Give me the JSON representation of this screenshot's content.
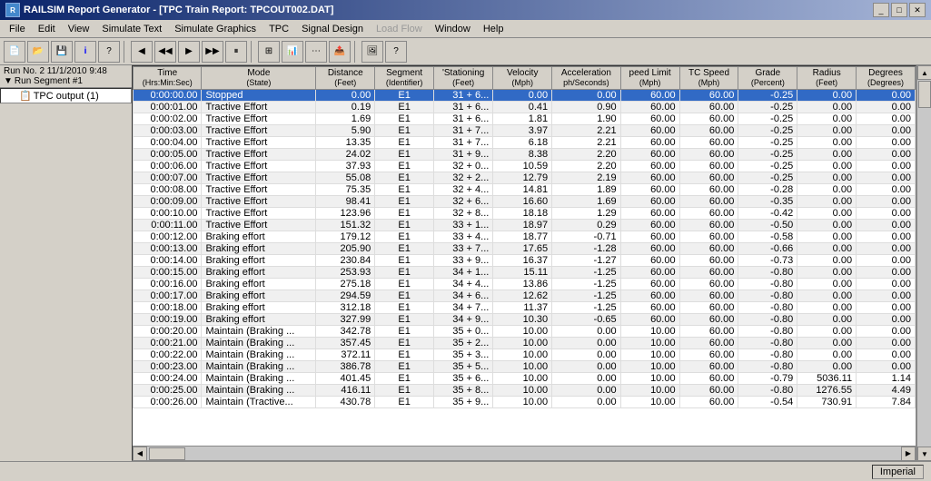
{
  "titleBar": {
    "title": "RAILSIM Report Generator - [TPC Train Report: TPCOUT002.DAT]",
    "icon": "R",
    "controls": [
      "_",
      "□",
      "✕"
    ]
  },
  "menuBar": {
    "items": [
      {
        "label": "File",
        "disabled": false
      },
      {
        "label": "Edit",
        "disabled": false
      },
      {
        "label": "View",
        "disabled": false
      },
      {
        "label": "Simulate Text",
        "disabled": false
      },
      {
        "label": "Simulate Graphics",
        "disabled": false
      },
      {
        "label": "TPC",
        "disabled": false
      },
      {
        "label": "Signal Design",
        "disabled": false
      },
      {
        "label": "Load Flow",
        "disabled": true
      },
      {
        "label": "Window",
        "disabled": false
      },
      {
        "label": "Help",
        "disabled": false
      }
    ]
  },
  "infoBar": {
    "runNo": "Run No. 2  11/1/2010 9:48",
    "segment": "Run Segment #1"
  },
  "treeItems": [
    {
      "label": "TPC output (1)",
      "level": 2
    }
  ],
  "tableHeaders": [
    {
      "label": "Time",
      "sub": "(Hrs:Min:Sec)"
    },
    {
      "label": "Mode",
      "sub": "(State)"
    },
    {
      "label": "Distance",
      "sub": "(Feet)"
    },
    {
      "label": "Segment",
      "sub": "(Identifier)"
    },
    {
      "label": "Stationing",
      "sub": "(Feet)"
    },
    {
      "label": "Velocity",
      "sub": "(Mph)"
    },
    {
      "label": "Acceleration",
      "sub": "ph/Seconds)"
    },
    {
      "label": "Speed Limit",
      "sub": "(Mph)"
    },
    {
      "label": "TC Speed",
      "sub": "(Mph)"
    },
    {
      "label": "Grade",
      "sub": "(Percent)"
    },
    {
      "label": "Radius",
      "sub": "(Feet)"
    },
    {
      "label": "Degrees",
      "sub": "(Degrees)"
    }
  ],
  "tableRows": [
    {
      "time": "0:00:00.00",
      "mode": "Stopped",
      "dist": "0.00",
      "seg": "E1",
      "stat": "31 + 6...",
      "vel": "0.00",
      "accel": "0.00",
      "speedLim": "60.00",
      "tcSpeed": "60.00",
      "grade": "-0.25",
      "radius": "0.00",
      "degrees": "0.00",
      "selected": true
    },
    {
      "time": "0:00:01.00",
      "mode": "Tractive Effort",
      "dist": "0.19",
      "seg": "E1",
      "stat": "31 + 6...",
      "vel": "0.41",
      "accel": "0.90",
      "speedLim": "60.00",
      "tcSpeed": "60.00",
      "grade": "-0.25",
      "radius": "0.00",
      "degrees": "0.00",
      "selected": false
    },
    {
      "time": "0:00:02.00",
      "mode": "Tractive Effort",
      "dist": "1.69",
      "seg": "E1",
      "stat": "31 + 6...",
      "vel": "1.81",
      "accel": "1.90",
      "speedLim": "60.00",
      "tcSpeed": "60.00",
      "grade": "-0.25",
      "radius": "0.00",
      "degrees": "0.00",
      "selected": false
    },
    {
      "time": "0:00:03.00",
      "mode": "Tractive Effort",
      "dist": "5.90",
      "seg": "E1",
      "stat": "31 + 7...",
      "vel": "3.97",
      "accel": "2.21",
      "speedLim": "60.00",
      "tcSpeed": "60.00",
      "grade": "-0.25",
      "radius": "0.00",
      "degrees": "0.00",
      "selected": false
    },
    {
      "time": "0:00:04.00",
      "mode": "Tractive Effort",
      "dist": "13.35",
      "seg": "E1",
      "stat": "31 + 7...",
      "vel": "6.18",
      "accel": "2.21",
      "speedLim": "60.00",
      "tcSpeed": "60.00",
      "grade": "-0.25",
      "radius": "0.00",
      "degrees": "0.00",
      "selected": false
    },
    {
      "time": "0:00:05.00",
      "mode": "Tractive Effort",
      "dist": "24.02",
      "seg": "E1",
      "stat": "31 + 9...",
      "vel": "8.38",
      "accel": "2.20",
      "speedLim": "60.00",
      "tcSpeed": "60.00",
      "grade": "-0.25",
      "radius": "0.00",
      "degrees": "0.00",
      "selected": false
    },
    {
      "time": "0:00:06.00",
      "mode": "Tractive Effort",
      "dist": "37.93",
      "seg": "E1",
      "stat": "32 + 0...",
      "vel": "10.59",
      "accel": "2.20",
      "speedLim": "60.00",
      "tcSpeed": "60.00",
      "grade": "-0.25",
      "radius": "0.00",
      "degrees": "0.00",
      "selected": false
    },
    {
      "time": "0:00:07.00",
      "mode": "Tractive Effort",
      "dist": "55.08",
      "seg": "E1",
      "stat": "32 + 2...",
      "vel": "12.79",
      "accel": "2.19",
      "speedLim": "60.00",
      "tcSpeed": "60.00",
      "grade": "-0.25",
      "radius": "0.00",
      "degrees": "0.00",
      "selected": false
    },
    {
      "time": "0:00:08.00",
      "mode": "Tractive Effort",
      "dist": "75.35",
      "seg": "E1",
      "stat": "32 + 4...",
      "vel": "14.81",
      "accel": "1.89",
      "speedLim": "60.00",
      "tcSpeed": "60.00",
      "grade": "-0.28",
      "radius": "0.00",
      "degrees": "0.00",
      "selected": false
    },
    {
      "time": "0:00:09.00",
      "mode": "Tractive Effort",
      "dist": "98.41",
      "seg": "E1",
      "stat": "32 + 6...",
      "vel": "16.60",
      "accel": "1.69",
      "speedLim": "60.00",
      "tcSpeed": "60.00",
      "grade": "-0.35",
      "radius": "0.00",
      "degrees": "0.00",
      "selected": false
    },
    {
      "time": "0:00:10.00",
      "mode": "Tractive Effort",
      "dist": "123.96",
      "seg": "E1",
      "stat": "32 + 8...",
      "vel": "18.18",
      "accel": "1.29",
      "speedLim": "60.00",
      "tcSpeed": "60.00",
      "grade": "-0.42",
      "radius": "0.00",
      "degrees": "0.00",
      "selected": false
    },
    {
      "time": "0:00:11.00",
      "mode": "Tractive Effort",
      "dist": "151.32",
      "seg": "E1",
      "stat": "33 + 1...",
      "vel": "18.97",
      "accel": "0.29",
      "speedLim": "60.00",
      "tcSpeed": "60.00",
      "grade": "-0.50",
      "radius": "0.00",
      "degrees": "0.00",
      "selected": false
    },
    {
      "time": "0:00:12.00",
      "mode": "Braking effort",
      "dist": "179.12",
      "seg": "E1",
      "stat": "33 + 4...",
      "vel": "18.77",
      "accel": "-0.71",
      "speedLim": "60.00",
      "tcSpeed": "60.00",
      "grade": "-0.58",
      "radius": "0.00",
      "degrees": "0.00",
      "selected": false
    },
    {
      "time": "0:00:13.00",
      "mode": "Braking effort",
      "dist": "205.90",
      "seg": "E1",
      "stat": "33 + 7...",
      "vel": "17.65",
      "accel": "-1.28",
      "speedLim": "60.00",
      "tcSpeed": "60.00",
      "grade": "-0.66",
      "radius": "0.00",
      "degrees": "0.00",
      "selected": false
    },
    {
      "time": "0:00:14.00",
      "mode": "Braking effort",
      "dist": "230.84",
      "seg": "E1",
      "stat": "33 + 9...",
      "vel": "16.37",
      "accel": "-1.27",
      "speedLim": "60.00",
      "tcSpeed": "60.00",
      "grade": "-0.73",
      "radius": "0.00",
      "degrees": "0.00",
      "selected": false
    },
    {
      "time": "0:00:15.00",
      "mode": "Braking effort",
      "dist": "253.93",
      "seg": "E1",
      "stat": "34 + 1...",
      "vel": "15.11",
      "accel": "-1.25",
      "speedLim": "60.00",
      "tcSpeed": "60.00",
      "grade": "-0.80",
      "radius": "0.00",
      "degrees": "0.00",
      "selected": false
    },
    {
      "time": "0:00:16.00",
      "mode": "Braking effort",
      "dist": "275.18",
      "seg": "E1",
      "stat": "34 + 4...",
      "vel": "13.86",
      "accel": "-1.25",
      "speedLim": "60.00",
      "tcSpeed": "60.00",
      "grade": "-0.80",
      "radius": "0.00",
      "degrees": "0.00",
      "selected": false
    },
    {
      "time": "0:00:17.00",
      "mode": "Braking effort",
      "dist": "294.59",
      "seg": "E1",
      "stat": "34 + 6...",
      "vel": "12.62",
      "accel": "-1.25",
      "speedLim": "60.00",
      "tcSpeed": "60.00",
      "grade": "-0.80",
      "radius": "0.00",
      "degrees": "0.00",
      "selected": false
    },
    {
      "time": "0:00:18.00",
      "mode": "Braking effort",
      "dist": "312.18",
      "seg": "E1",
      "stat": "34 + 7...",
      "vel": "11.37",
      "accel": "-1.25",
      "speedLim": "60.00",
      "tcSpeed": "60.00",
      "grade": "-0.80",
      "radius": "0.00",
      "degrees": "0.00",
      "selected": false
    },
    {
      "time": "0:00:19.00",
      "mode": "Braking effort",
      "dist": "327.99",
      "seg": "E1",
      "stat": "34 + 9...",
      "vel": "10.30",
      "accel": "-0.65",
      "speedLim": "60.00",
      "tcSpeed": "60.00",
      "grade": "-0.80",
      "radius": "0.00",
      "degrees": "0.00",
      "selected": false
    },
    {
      "time": "0:00:20.00",
      "mode": "Maintain (Braking ...",
      "dist": "342.78",
      "seg": "E1",
      "stat": "35 + 0...",
      "vel": "10.00",
      "accel": "0.00",
      "speedLim": "10.00",
      "tcSpeed": "60.00",
      "grade": "-0.80",
      "radius": "0.00",
      "degrees": "0.00",
      "selected": false
    },
    {
      "time": "0:00:21.00",
      "mode": "Maintain (Braking ...",
      "dist": "357.45",
      "seg": "E1",
      "stat": "35 + 2...",
      "vel": "10.00",
      "accel": "0.00",
      "speedLim": "10.00",
      "tcSpeed": "60.00",
      "grade": "-0.80",
      "radius": "0.00",
      "degrees": "0.00",
      "selected": false
    },
    {
      "time": "0:00:22.00",
      "mode": "Maintain (Braking ...",
      "dist": "372.11",
      "seg": "E1",
      "stat": "35 + 3...",
      "vel": "10.00",
      "accel": "0.00",
      "speedLim": "10.00",
      "tcSpeed": "60.00",
      "grade": "-0.80",
      "radius": "0.00",
      "degrees": "0.00",
      "selected": false
    },
    {
      "time": "0:00:23.00",
      "mode": "Maintain (Braking ...",
      "dist": "386.78",
      "seg": "E1",
      "stat": "35 + 5...",
      "vel": "10.00",
      "accel": "0.00",
      "speedLim": "10.00",
      "tcSpeed": "60.00",
      "grade": "-0.80",
      "radius": "0.00",
      "degrees": "0.00",
      "selected": false
    },
    {
      "time": "0:00:24.00",
      "mode": "Maintain (Braking ...",
      "dist": "401.45",
      "seg": "E1",
      "stat": "35 + 6...",
      "vel": "10.00",
      "accel": "0.00",
      "speedLim": "10.00",
      "tcSpeed": "60.00",
      "grade": "-0.79",
      "radius": "5036.11",
      "degrees": "1.14",
      "selected": false
    },
    {
      "time": "0:00:25.00",
      "mode": "Maintain (Braking ...",
      "dist": "416.11",
      "seg": "E1",
      "stat": "35 + 8...",
      "vel": "10.00",
      "accel": "0.00",
      "speedLim": "10.00",
      "tcSpeed": "60.00",
      "grade": "-0.80",
      "radius": "1276.55",
      "degrees": "4.49",
      "selected": false
    },
    {
      "time": "0:00:26.00",
      "mode": "Maintain (Tractive...",
      "dist": "430.78",
      "seg": "E1",
      "stat": "35 + 9...",
      "vel": "10.00",
      "accel": "0.00",
      "speedLim": "10.00",
      "tcSpeed": "60.00",
      "grade": "-0.54",
      "radius": "730.91",
      "degrees": "7.84",
      "selected": false
    }
  ],
  "statusBar": {
    "label": "Imperial"
  },
  "colors": {
    "titleBg": "#0a246a",
    "selectedRow": "#316ac5",
    "menuBg": "#d4d0c8",
    "headerBg": "#d4d0c8"
  }
}
